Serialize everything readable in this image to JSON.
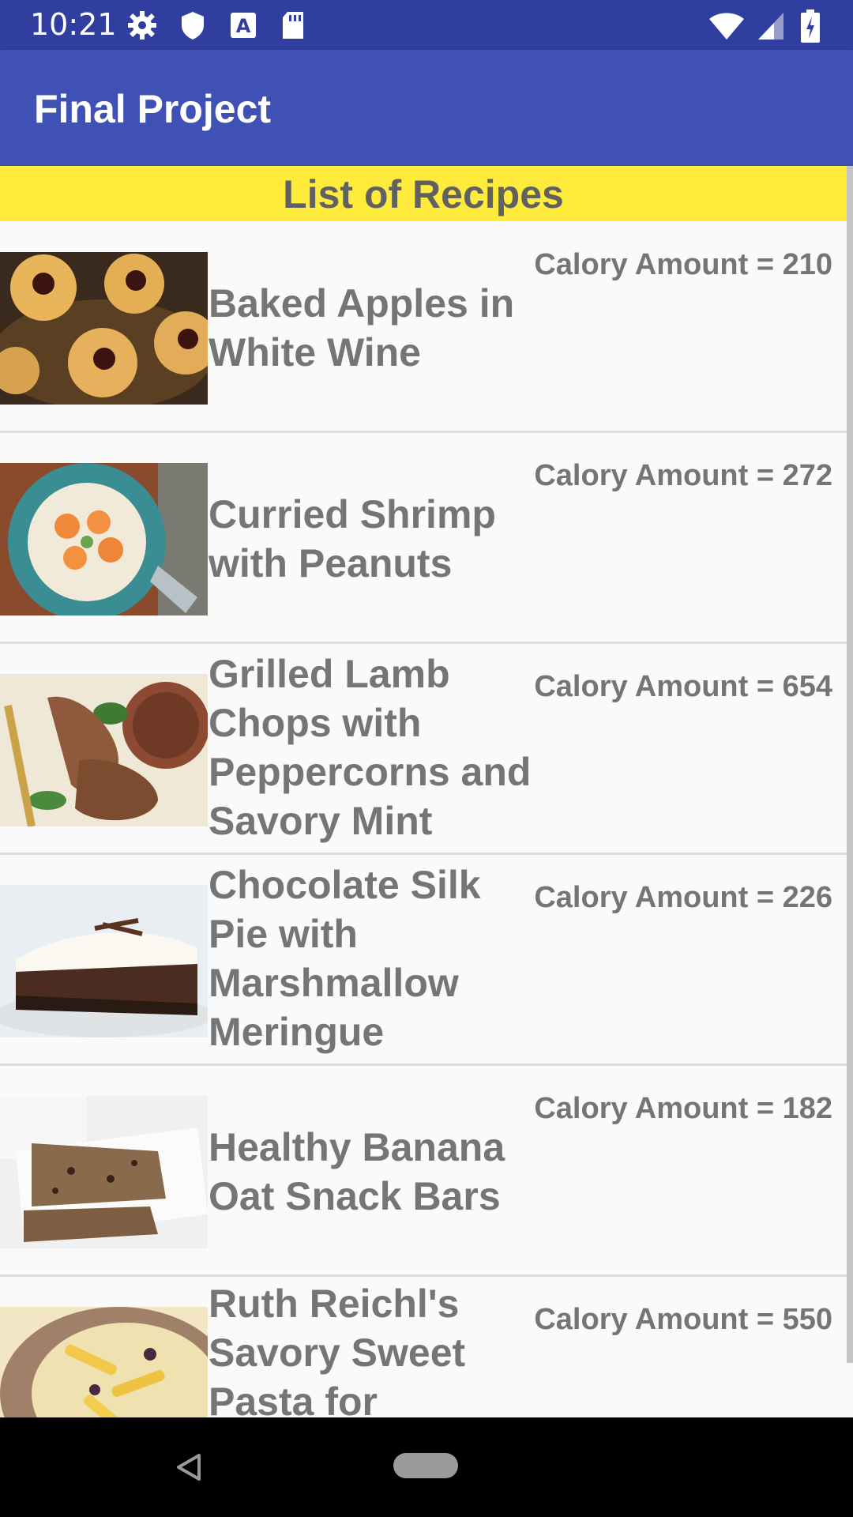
{
  "status_bar": {
    "time": "10:21",
    "left_icons": [
      "gear-icon",
      "shield-icon",
      "text-a-icon",
      "sd-card-icon"
    ],
    "right_icons": [
      "wifi-icon",
      "signal-icon",
      "battery-charging-icon"
    ]
  },
  "app_bar": {
    "title": "Final Project"
  },
  "list_header": {
    "title": "List of Recipes"
  },
  "recipes": [
    {
      "name": "Baked Apples in White Wine",
      "calories": "Calory Amount = 210",
      "image": "baked-apples-photo"
    },
    {
      "name": "Curried Shrimp with Peanuts",
      "calories": "Calory Amount = 272",
      "image": "curried-shrimp-photo"
    },
    {
      "name": "Grilled Lamb Chops with Peppercorns and Savory Mint",
      "calories": "Calory Amount = 654",
      "image": "lamb-chops-photo"
    },
    {
      "name": "Chocolate Silk Pie with Marshmallow Meringue",
      "calories": "Calory Amount = 226",
      "image": "chocolate-pie-photo"
    },
    {
      "name": "Healthy Banana Oat Snack Bars",
      "calories": "Calory Amount = 182",
      "image": "oat-bars-photo"
    },
    {
      "name": "Ruth Reichl's Savory Sweet Pasta for",
      "calories": "Calory Amount = 550",
      "image": "pasta-photo"
    }
  ],
  "nav_bar": {
    "icons": [
      "back-icon",
      "home-pill-icon"
    ]
  },
  "colors": {
    "status_bar": "#303f9f",
    "app_bar": "#3f51b5",
    "header": "#ffeb3b",
    "text": "#757575"
  }
}
